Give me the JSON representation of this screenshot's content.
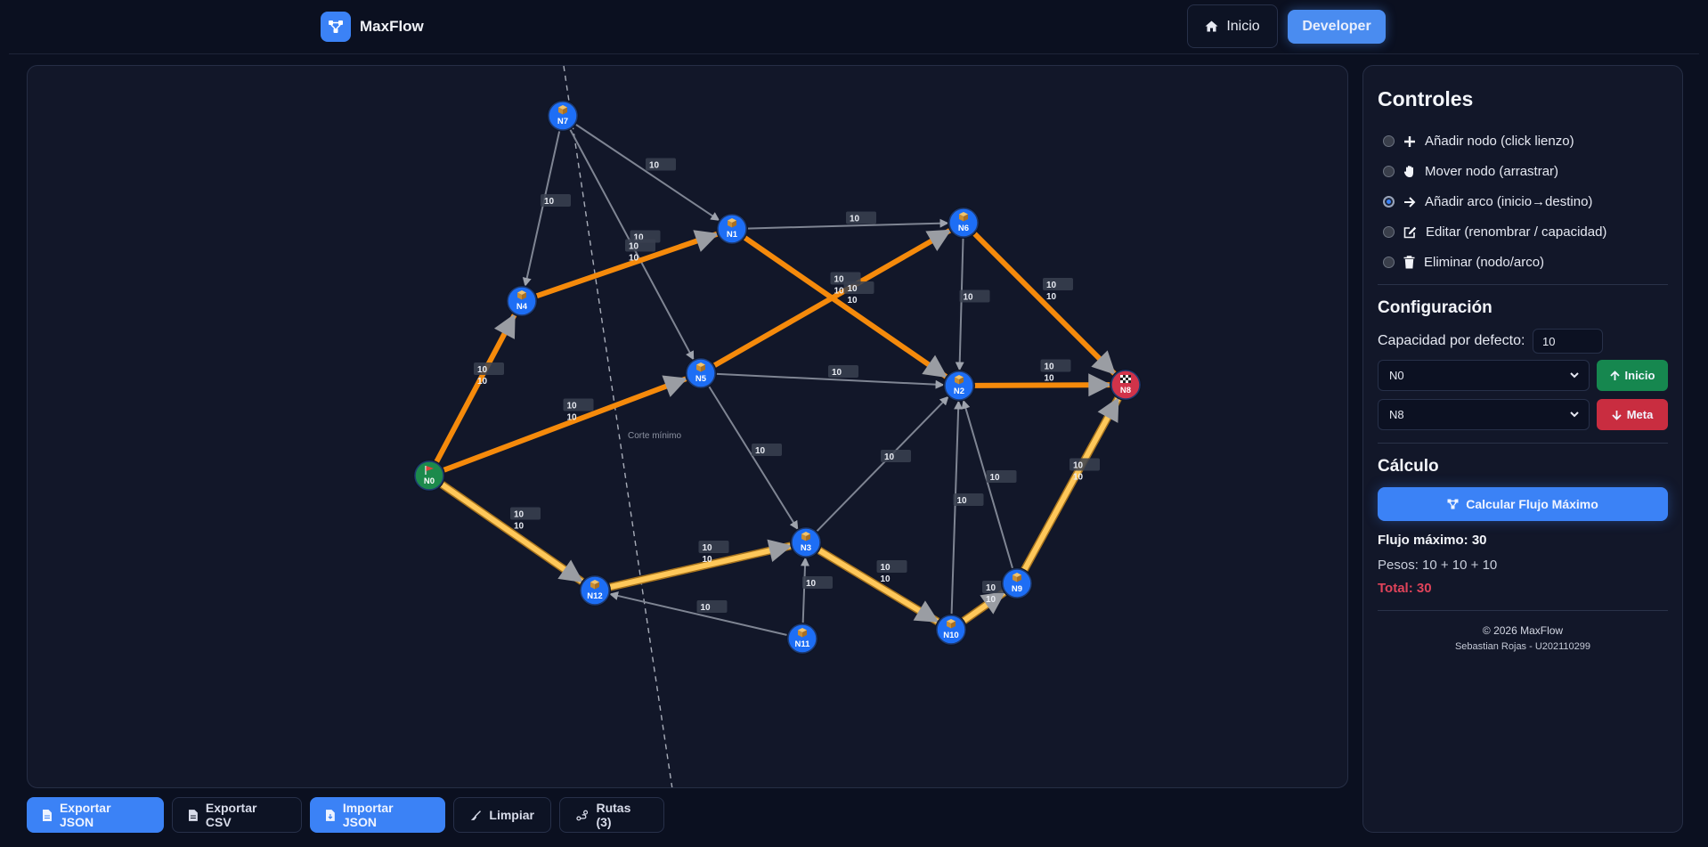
{
  "header": {
    "brand": "MaxFlow",
    "nav_inicio": "Inicio",
    "nav_developer": "Developer"
  },
  "graph": {
    "cut_label": "Corte mínimo",
    "nodes": [
      {
        "id": "N0",
        "kind": "source",
        "icon": "flag-icon"
      },
      {
        "id": "N1",
        "kind": "normal",
        "icon": "box-icon"
      },
      {
        "id": "N2",
        "kind": "normal",
        "icon": "box-icon"
      },
      {
        "id": "N3",
        "kind": "normal",
        "icon": "box-icon"
      },
      {
        "id": "N4",
        "kind": "normal",
        "icon": "box-icon"
      },
      {
        "id": "N5",
        "kind": "normal",
        "icon": "box-icon"
      },
      {
        "id": "N6",
        "kind": "normal",
        "icon": "box-icon"
      },
      {
        "id": "N7",
        "kind": "normal",
        "icon": "box-icon"
      },
      {
        "id": "N8",
        "kind": "sink",
        "icon": "checkered-flag-icon"
      },
      {
        "id": "N9",
        "kind": "normal",
        "icon": "box-icon"
      },
      {
        "id": "N10",
        "kind": "normal",
        "icon": "box-icon"
      },
      {
        "id": "N11",
        "kind": "normal",
        "icon": "box-icon"
      },
      {
        "id": "N12",
        "kind": "normal",
        "icon": "box-icon"
      }
    ],
    "edges": [
      {
        "from": "N7",
        "to": "N4",
        "capacity": "10",
        "flow": "",
        "style": "none"
      },
      {
        "from": "N7",
        "to": "N1",
        "capacity": "10",
        "flow": "",
        "style": "none"
      },
      {
        "from": "N7",
        "to": "N5",
        "capacity": "10",
        "flow": "",
        "style": "none"
      },
      {
        "from": "N1",
        "to": "N6",
        "capacity": "10",
        "flow": "",
        "style": "none"
      },
      {
        "from": "N4",
        "to": "N1",
        "capacity": "10",
        "flow": "10",
        "style": "orange"
      },
      {
        "from": "N0",
        "to": "N4",
        "capacity": "10",
        "flow": "10",
        "style": "orange"
      },
      {
        "from": "N0",
        "to": "N5",
        "capacity": "10",
        "flow": "10",
        "style": "orange"
      },
      {
        "from": "N5",
        "to": "N6",
        "capacity": "10",
        "flow": "10",
        "style": "orange"
      },
      {
        "from": "N1",
        "to": "N2",
        "capacity": "10",
        "flow": "10",
        "style": "orange"
      },
      {
        "from": "N6",
        "to": "N8",
        "capacity": "10",
        "flow": "10",
        "style": "orange"
      },
      {
        "from": "N2",
        "to": "N8",
        "capacity": "10",
        "flow": "10",
        "style": "orange"
      },
      {
        "from": "N6",
        "to": "N2",
        "capacity": "10",
        "flow": "",
        "style": "none"
      },
      {
        "from": "N5",
        "to": "N2",
        "capacity": "10",
        "flow": "",
        "style": "none"
      },
      {
        "from": "N5",
        "to": "N3",
        "capacity": "10",
        "flow": "",
        "style": "none"
      },
      {
        "from": "N3",
        "to": "N2",
        "capacity": "10",
        "flow": "",
        "style": "none"
      },
      {
        "from": "N10",
        "to": "N2",
        "capacity": "10",
        "flow": "",
        "style": "none"
      },
      {
        "from": "N9",
        "to": "N2",
        "capacity": "10",
        "flow": "",
        "style": "none"
      },
      {
        "from": "N0",
        "to": "N12",
        "capacity": "10",
        "flow": "10",
        "style": "yellow"
      },
      {
        "from": "N12",
        "to": "N3",
        "capacity": "10",
        "flow": "10",
        "style": "yellow"
      },
      {
        "from": "N3",
        "to": "N10",
        "capacity": "10",
        "flow": "10",
        "style": "yellow"
      },
      {
        "from": "N10",
        "to": "N9",
        "capacity": "10",
        "flow": "10",
        "style": "yellow"
      },
      {
        "from": "N9",
        "to": "N8",
        "capacity": "10",
        "flow": "10",
        "style": "yellow"
      },
      {
        "from": "N11",
        "to": "N12",
        "capacity": "10",
        "flow": "",
        "style": "none"
      },
      {
        "from": "N11",
        "to": "N3",
        "capacity": "10",
        "flow": "",
        "style": "none"
      }
    ]
  },
  "toolbar": {
    "export_json": "Exportar JSON",
    "export_csv": "Exportar CSV",
    "import_json": "Importar JSON",
    "clear": "Limpiar",
    "routes": "Rutas (3)"
  },
  "panel": {
    "title": "Controles",
    "modes": [
      {
        "label": "Añadir nodo (click lienzo)",
        "icon": "plus-icon",
        "selected": false
      },
      {
        "label": "Mover nodo (arrastrar)",
        "icon": "hand-icon",
        "selected": false
      },
      {
        "label": "Añadir arco (inicio→destino)",
        "icon": "arrow-right-icon",
        "selected": true
      },
      {
        "label": "Editar (renombrar / capacidad)",
        "icon": "edit-icon",
        "selected": false
      },
      {
        "label": "Eliminar (nodo/arco)",
        "icon": "trash-icon",
        "selected": false
      }
    ],
    "config_title": "Configuración",
    "default_capacity_label": "Capacidad por defecto:",
    "default_capacity_value": "10",
    "source_select": "N0",
    "sink_select": "N8",
    "start_button": "Inicio",
    "goal_button": "Meta",
    "calc_title": "Cálculo",
    "calc_button": "Calcular Flujo Máximo",
    "max_flow": "Flujo máximo: 30",
    "weights": "Pesos: 10 + 10 + 10",
    "total": "Total: 30",
    "copyright": "© 2026 MaxFlow",
    "author": "Sebastian Rojas - U202110299"
  },
  "colors": {
    "accent": "#3b82f6",
    "orange_flow": "#f58a0b",
    "yellow_flow": "#ffc85a",
    "source_node": "#1c8a4c",
    "sink_node": "#d1334a",
    "node": "#1d6ef5"
  }
}
